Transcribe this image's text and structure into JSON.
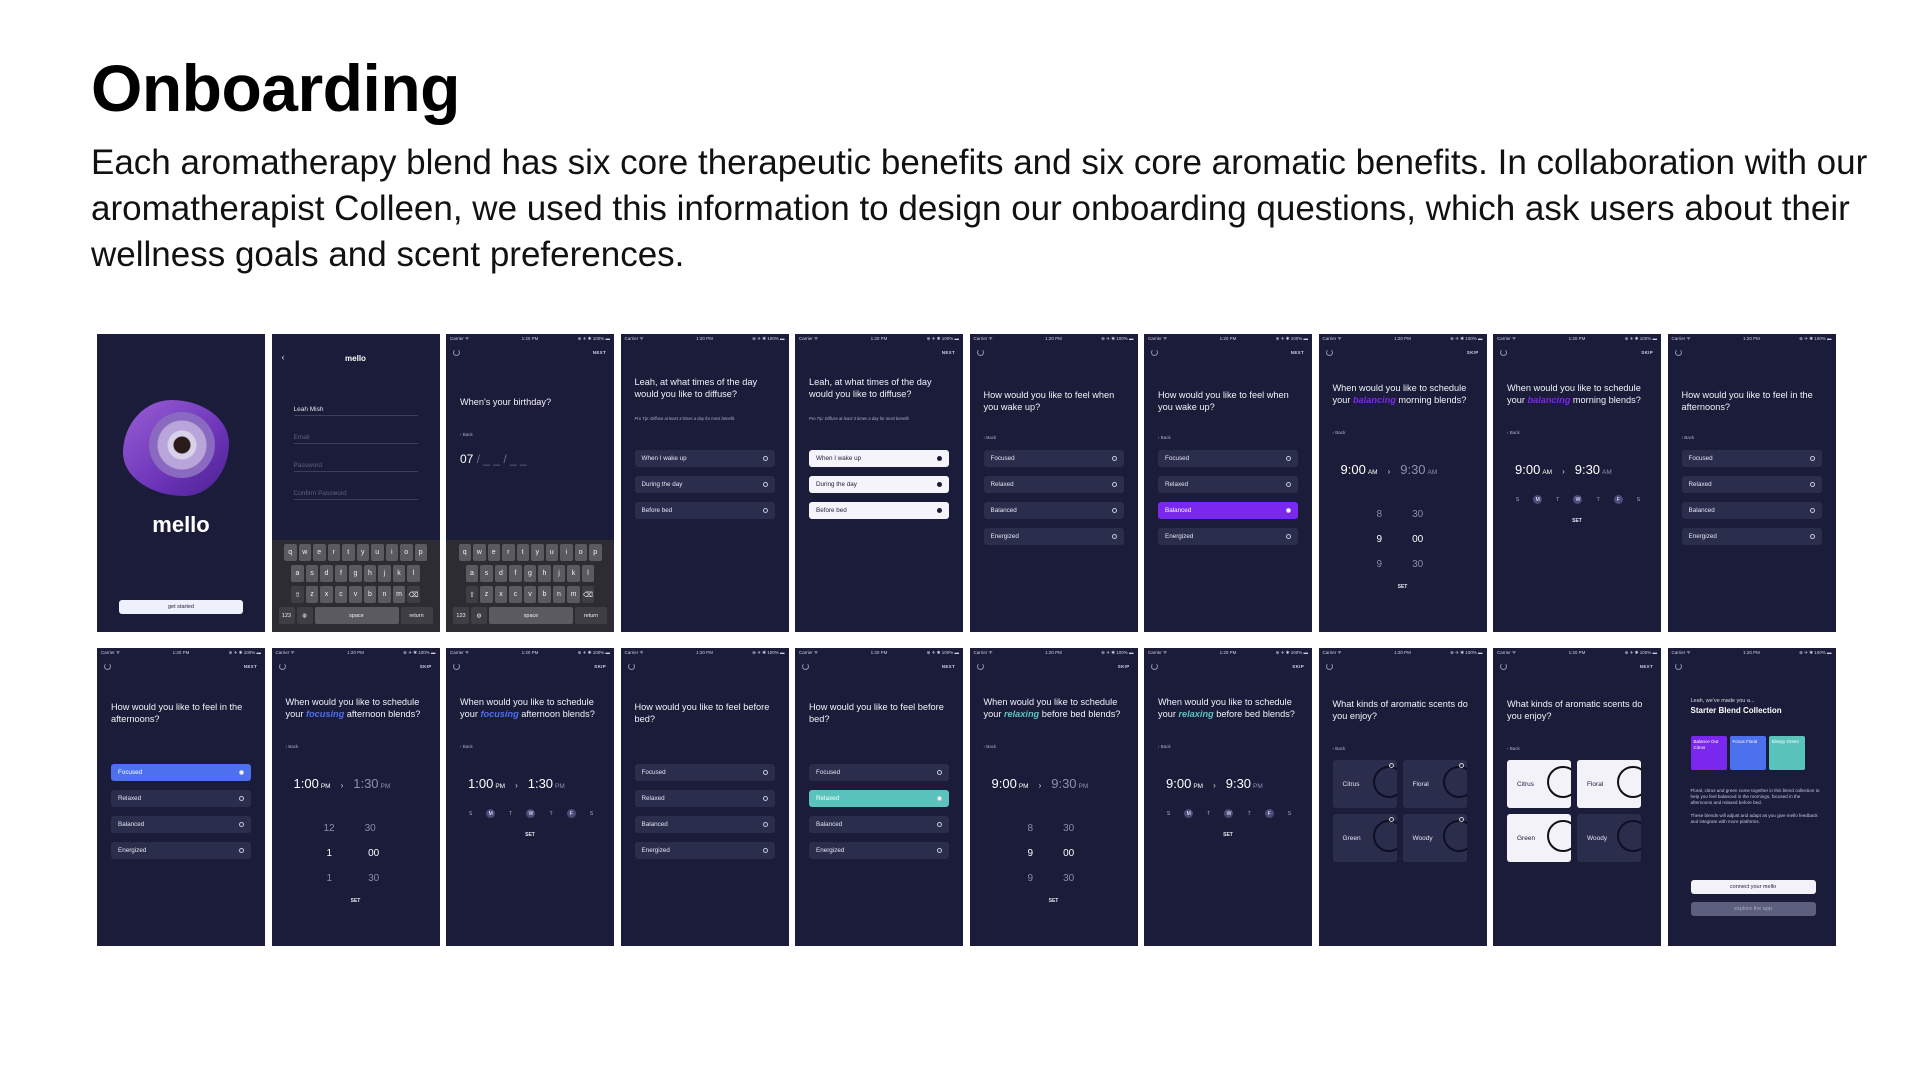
{
  "page": {
    "title": "Onboarding",
    "description": "Each aromatherapy blend has six core therapeutic benefits and six core aromatic benefits. In collaboration with our aromatherapist Colleen, we used this information to design our onboarding questions, which ask users about their wellness goals and scent preferences."
  },
  "status_bar": {
    "carrier": "Carrier ᯤ",
    "time": "1:20 PM",
    "battery": "⊕ ✈ ✱ 100% ▬"
  },
  "actions": {
    "next": "NEXT",
    "skip": "SKIP",
    "back": "‹ Back",
    "set": "SET"
  },
  "options": {
    "focused": "Focused",
    "relaxed": "Relaxed",
    "balanced": "Balanced",
    "energized": "Energized"
  },
  "diffuse_options": {
    "wake": "When I wake up",
    "day": "During the day",
    "bed": "Before bed"
  },
  "splash": {
    "brand": "mello",
    "cta": "get started"
  },
  "signup": {
    "app_title": "mello",
    "name_value": "Leah Mish",
    "email_placeholder": "Email",
    "password_placeholder": "Password",
    "confirm_placeholder": "Confirm Password"
  },
  "keyboard": {
    "row1": [
      "q",
      "w",
      "e",
      "r",
      "t",
      "y",
      "u",
      "i",
      "o",
      "p"
    ],
    "row2": [
      "a",
      "s",
      "d",
      "f",
      "g",
      "h",
      "j",
      "k",
      "l"
    ],
    "row3": [
      "z",
      "x",
      "c",
      "v",
      "b",
      "n",
      "m"
    ],
    "space": "space",
    "return": "return",
    "num": "123"
  },
  "birthday": {
    "question": "When's your birthday?",
    "month": "07",
    "rest": " / _ _ / _ _"
  },
  "diffuse": {
    "question": "Leah, at what times of the day would you like to diffuse?",
    "tip": "Pro Tip: Diffuse at least 3 times a day for most benefit."
  },
  "wake": {
    "question": "How would you like to feel when you wake up?"
  },
  "morning_schedule": {
    "pre": "When would you like to schedule your ",
    "highlight": "balancing",
    "post": " morning blends?",
    "start": "9:00",
    "end": "9:30",
    "ampm": "AM",
    "picker": [
      [
        "8",
        "30"
      ],
      [
        "9",
        "00"
      ],
      [
        "9",
        "30"
      ]
    ]
  },
  "afternoon": {
    "question": "How would you like to feel in the afternoons?"
  },
  "afternoon_schedule": {
    "pre": "When would you like to schedule your ",
    "highlight": "focusing",
    "post": " afternoon blends?",
    "start": "1:00",
    "end": "1:30",
    "ampm": "PM",
    "picker": [
      [
        "12",
        "30"
      ],
      [
        "1",
        "00"
      ],
      [
        "1",
        "30"
      ]
    ]
  },
  "bed": {
    "question": "How would you like to feel before bed?"
  },
  "bed_schedule": {
    "pre": "When would you like to schedule your ",
    "highlight": "relaxing",
    "post": " before bed blends?",
    "start": "9:00",
    "end": "9:30",
    "ampm": "PM",
    "picker": [
      [
        "8",
        "30"
      ],
      [
        "9",
        "00"
      ],
      [
        "9",
        "30"
      ]
    ]
  },
  "days": [
    "S",
    "M",
    "T",
    "W",
    "T",
    "F",
    "S"
  ],
  "scents": {
    "question": "What kinds of aromatic scents do you enjoy?",
    "citrus": "Citrus",
    "floral": "Floral",
    "green": "Green",
    "woody": "Woody"
  },
  "results": {
    "greeting": "Leah, we've made you a...",
    "title": "Starter Blend Collection",
    "cards": [
      {
        "name": "Balance Out Citrus",
        "color": "#7a28f0"
      },
      {
        "name": "Focus Floral",
        "color": "#4d70ee"
      },
      {
        "name": "Sleepy Green",
        "color": "#5ac4bc"
      }
    ],
    "para1": "Floral, citrus and green come together in this blend collection to help you feel balanced in the mornings, focused in the afternoons and relaxed before bed.",
    "para2": "These blends will adjust and adapt as you give mello feedback and integrate with more platforms.",
    "connect": "connect your mello",
    "explore": "explore the app"
  },
  "colors": {
    "screen_bg": "#1b1c39",
    "purple": "#7a28f0",
    "blue": "#4d70ee",
    "teal": "#5ac4bc"
  }
}
